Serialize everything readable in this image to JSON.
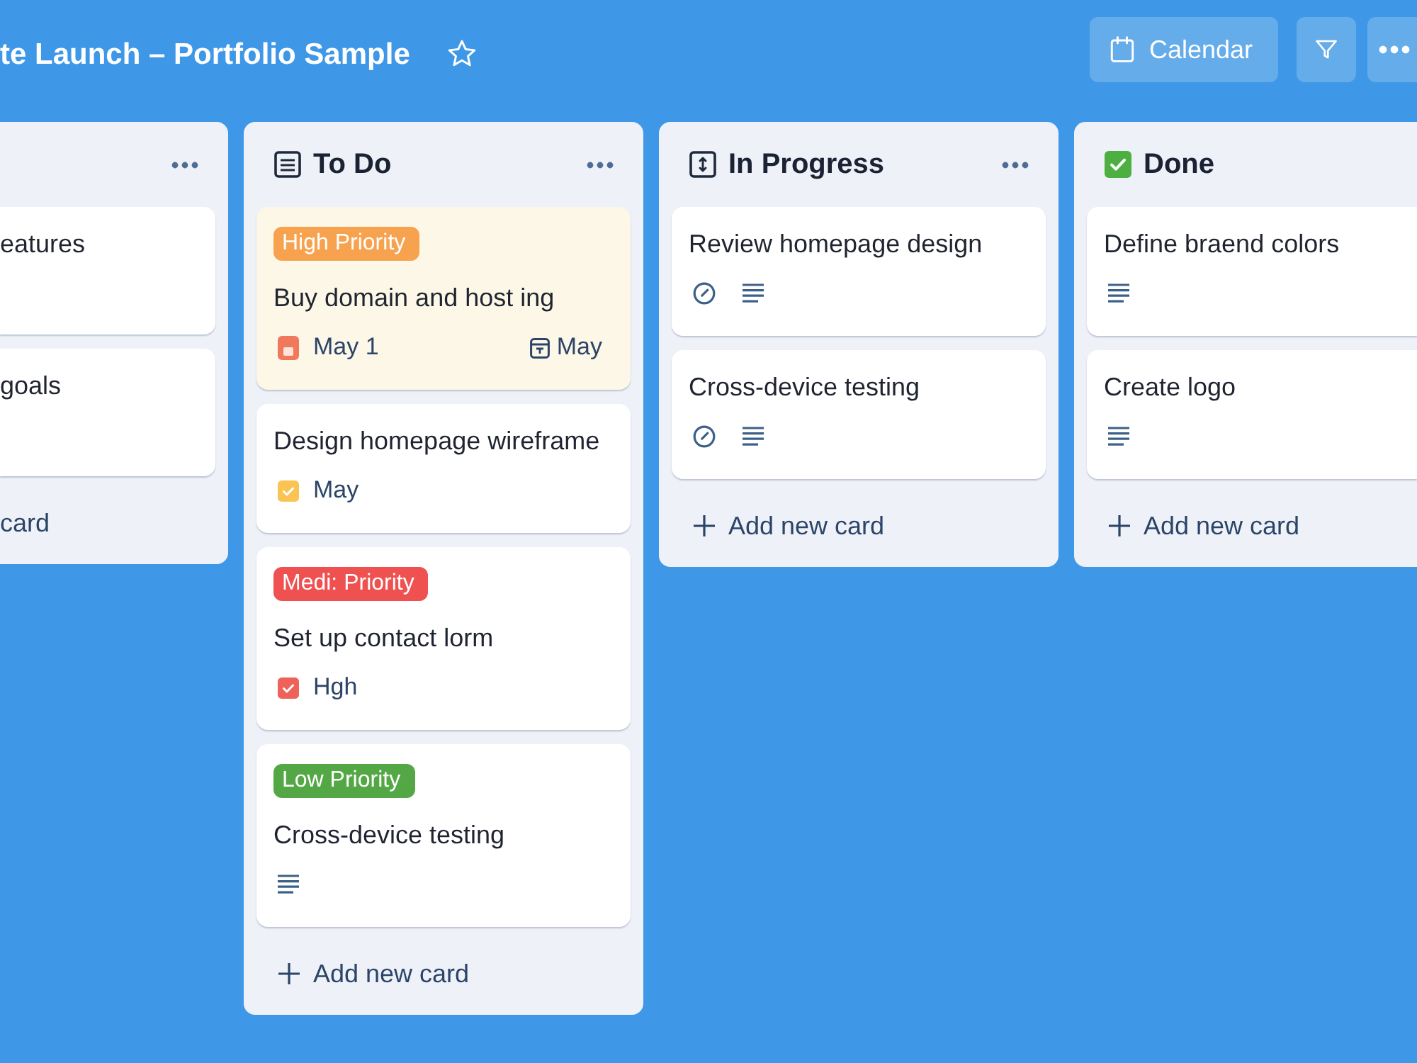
{
  "board": {
    "title": "te Launch – Portfolio Sample",
    "starred": false
  },
  "toolbar": [
    {
      "kind": "calendar",
      "label": "Calendar"
    },
    {
      "kind": "filter"
    },
    {
      "kind": "more"
    }
  ],
  "columns": [
    {
      "clipped_left": true,
      "clipped_right": false,
      "menu": true,
      "cards": [
        {
          "title": "eatures",
          "highlighted": false
        },
        {
          "title": "goals",
          "highlighted": false
        }
      ],
      "add": {
        "plus": false,
        "label": "card"
      }
    },
    {
      "kind": "list",
      "title": "To Do",
      "clipped_left": false,
      "clipped_right": false,
      "menu": true,
      "cards": [
        {
          "labels": [
            {
              "text": "High Priority",
              "color": "#f7a24f"
            }
          ],
          "title": "Buy domain and host ing",
          "highlighted": true,
          "meta": [
            {
              "kind": "due",
              "text": "May 1",
              "color": "#f0795c"
            },
            {
              "kind": "calendar",
              "text": "May"
            }
          ]
        },
        {
          "title": "Design homepage wireframe",
          "highlighted": false,
          "meta": [
            {
              "kind": "check",
              "text": "May",
              "color": "#fac453"
            }
          ]
        },
        {
          "labels": [
            {
              "text": "Medi: Priority",
              "color": "#ef5050"
            }
          ],
          "title": "Set up contact lorm",
          "highlighted": false,
          "meta": [
            {
              "kind": "check",
              "text": "Hgh",
              "color": "#ee6259"
            }
          ]
        },
        {
          "labels": [
            {
              "text": "Low Priority",
              "color": "#53a845"
            }
          ],
          "title": "Cross-device testing",
          "highlighted": false,
          "meta": [
            {
              "kind": "description"
            }
          ]
        }
      ],
      "add": {
        "plus": true,
        "label": "Add new card"
      }
    },
    {
      "kind": "progress",
      "title": "In Progress",
      "clipped_left": false,
      "clipped_right": false,
      "menu": true,
      "cards": [
        {
          "title": "Review homepage design",
          "highlighted": false,
          "meta": [
            {
              "kind": "gauge"
            },
            {
              "kind": "description"
            }
          ]
        },
        {
          "title": "Cross-device testing",
          "highlighted": false,
          "meta": [
            {
              "kind": "gauge"
            },
            {
              "kind": "description"
            }
          ]
        }
      ],
      "add": {
        "plus": true,
        "label": "Add new card"
      }
    },
    {
      "kind": "done",
      "title": "Done",
      "clipped_left": false,
      "clipped_right": true,
      "menu": false,
      "cards": [
        {
          "title": "Define braend colors",
          "highlighted": false,
          "meta": [
            {
              "kind": "description"
            }
          ]
        },
        {
          "title": "Create logo",
          "highlighted": false,
          "meta": [
            {
              "kind": "description"
            }
          ]
        }
      ],
      "add": {
        "plus": true,
        "label": "Add new card"
      }
    }
  ]
}
